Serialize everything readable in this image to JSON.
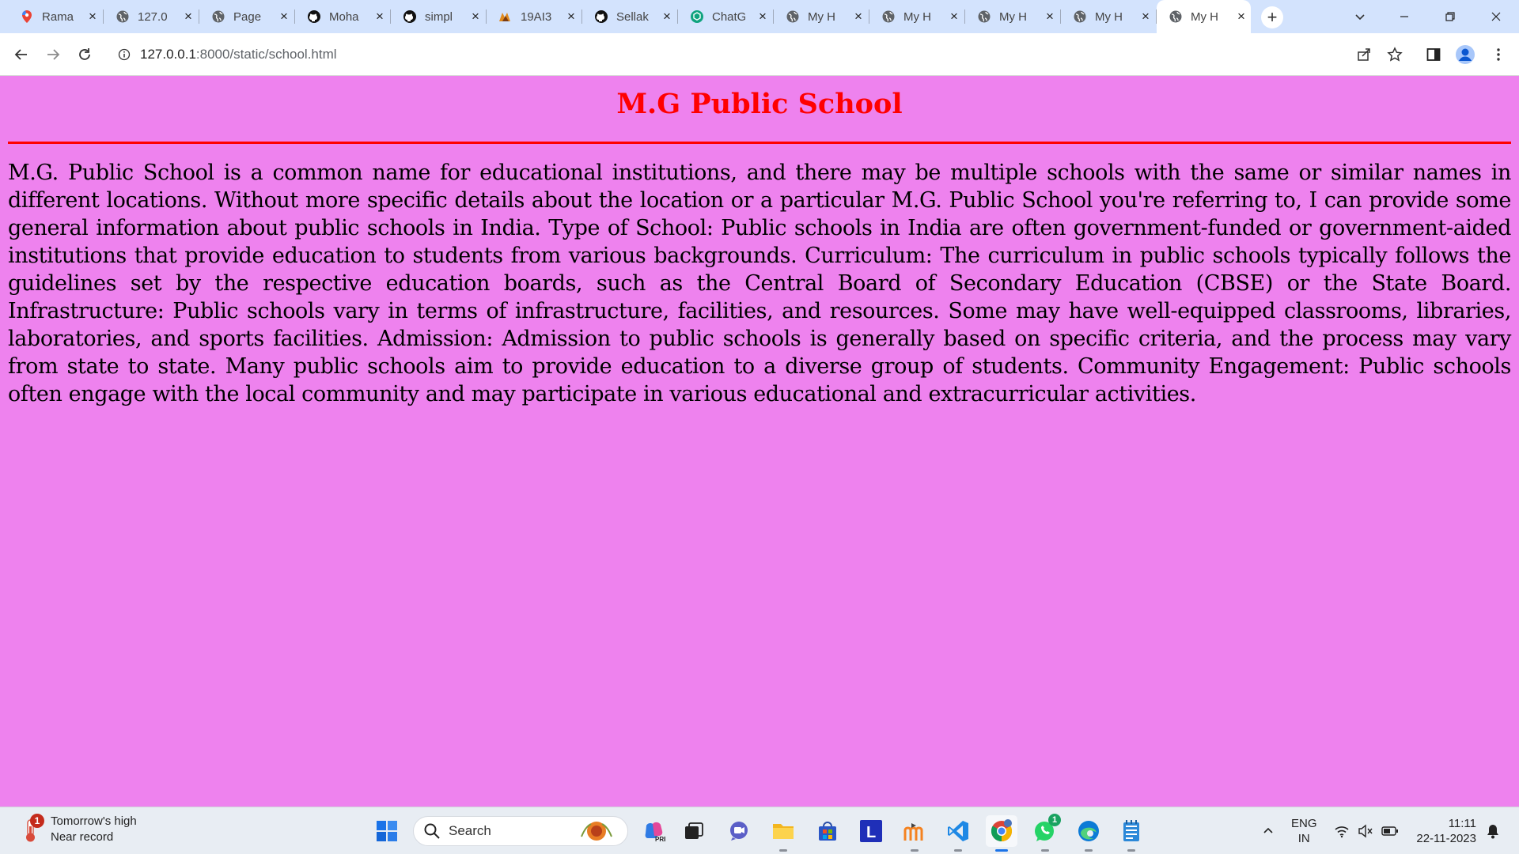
{
  "browser": {
    "tabs": [
      {
        "title": "Rama",
        "icon": "google-maps-icon"
      },
      {
        "title": "127.0",
        "icon": "globe-icon"
      },
      {
        "title": "Page",
        "icon": "globe-icon"
      },
      {
        "title": "Moha",
        "icon": "github-icon"
      },
      {
        "title": "simpl",
        "icon": "github-icon"
      },
      {
        "title": "19AI3",
        "icon": "site-logo-icon"
      },
      {
        "title": "Sellak",
        "icon": "github-icon"
      },
      {
        "title": "ChatG",
        "icon": "chatgpt-icon"
      },
      {
        "title": "My H",
        "icon": "globe-icon"
      },
      {
        "title": "My H",
        "icon": "globe-icon"
      },
      {
        "title": "My H",
        "icon": "globe-icon"
      },
      {
        "title": "My H",
        "icon": "globe-icon"
      },
      {
        "title": "My H",
        "icon": "globe-icon",
        "active": true
      }
    ],
    "close_glyph": "×",
    "new_tab_glyph": "+",
    "url_host": "127.0.0.1",
    "url_rest": ":8000/static/school.html"
  },
  "page": {
    "title": "M.G Public School",
    "body": "M.G. Public School is a common name for educational institutions, and there may be multiple schools with the same or similar names in different locations. Without more specific details about the location or a particular M.G. Public School you're referring to, I can provide some general information about public schools in India. Type of School: Public schools in India are often government-funded or government-aided institutions that provide education to students from various backgrounds. Curriculum: The curriculum in public schools typically follows the guidelines set by the respective education boards, such as the Central Board of Secondary Education (CBSE) or the State Board. Infrastructure: Public schools vary in terms of infrastructure, facilities, and resources. Some may have well-equipped classrooms, libraries, laboratories, and sports facilities. Admission: Admission to public schools is generally based on specific criteria, and the process may vary from state to state. Many public schools aim to provide education to a diverse group of students. Community Engagement: Public schools often engage with the local community and may participate in various educational and extracurricular activities.",
    "colors": {
      "background": "#ee82ee",
      "title": "#ff0000",
      "rule": "#ff0000"
    }
  },
  "taskbar": {
    "weather_line1": "Tomorrow's high",
    "weather_line2": "Near record",
    "weather_badge": "1",
    "search_label": "Search",
    "whatsapp_badge": "1",
    "lang_line1": "ENG",
    "lang_line2": "IN",
    "time": "11:11",
    "date": "22-11-2023"
  }
}
